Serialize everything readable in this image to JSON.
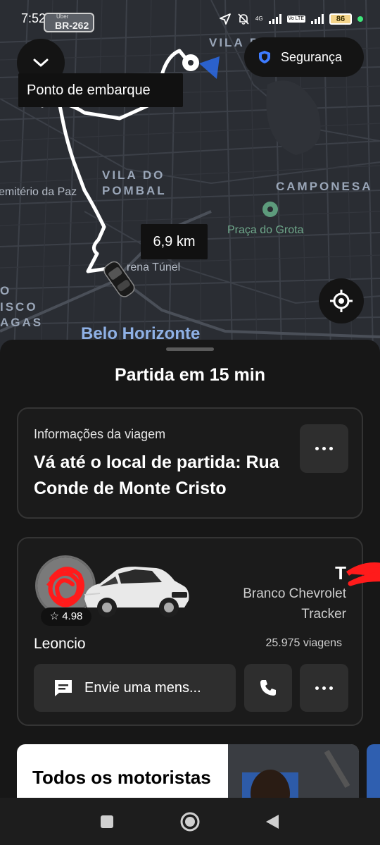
{
  "status_bar": {
    "time": "7:52",
    "road_badge_small": "Uber",
    "road_badge": "BR-262",
    "network_4g": "4G",
    "volte": "Vo LTE",
    "battery": "86"
  },
  "map": {
    "labels": {
      "vila_top": "VILA P",
      "vila_pombal_1": "VILA DO",
      "vila_pombal_2": "POMBAL",
      "cemiterio": "emitério da Paz",
      "camponesa": "CAMPONESA",
      "praca": "Praça do Grota",
      "arena": "rena Túnel",
      "isco": "ISCO",
      "agas": "AGAS",
      "o_left": "O",
      "city": "Belo Horizonte"
    },
    "pickup_label": "Ponto de embarque",
    "security_label": "Segurança",
    "distance": "6,9 km"
  },
  "sheet": {
    "title": "Partida em 15 min",
    "trip_info": {
      "subtitle": "Informações da viagem",
      "instruction": "Vá até o local de partida: Rua Conde de Monte Cristo"
    },
    "driver": {
      "rating": "4.98",
      "plate": "T",
      "car_model": "Branco Chevrolet Tracker",
      "name": "Leoncio",
      "trips": "25.975 viagens",
      "message_label": "Envie uma mens..."
    },
    "promo": {
      "title": "Todos os motoristas"
    }
  },
  "colors": {
    "map_bg": "#2a2d33",
    "sheet_bg": "#171717",
    "card_border": "#343434",
    "button_bg": "#2e2e2e",
    "route": "#ffffff",
    "accent_blue": "#2c6be8",
    "security_shield": "#3d7bff",
    "scribble_red": "#ff1b1b"
  }
}
